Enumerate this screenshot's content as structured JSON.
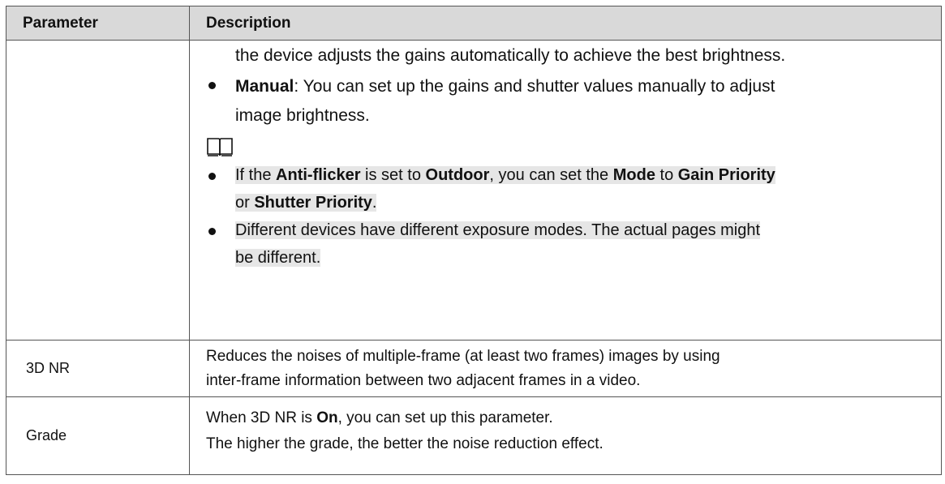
{
  "header": {
    "param": "Parameter",
    "desc": "Description"
  },
  "row1": {
    "line_cont": "the device adjusts the gains automatically to achieve the best brightness.",
    "manual_b": "Manual",
    "manual_t1": ": You can set up the gains and shutter values manually to adjust",
    "manual_t2": "image brightness.",
    "note1_a": "If the ",
    "note1_b1": "Anti-flicker",
    "note1_c": " is set to ",
    "note1_b2": "Outdoor",
    "note1_d": ", you can set the ",
    "note1_b3": "Mode",
    "note1_e": " to ",
    "note1_b4": "Gain Priority",
    "note1_f": "or ",
    "note1_b5": "Shutter Priority",
    "note1_g": ".",
    "note2_a": "Different devices have different exposure modes. The actual pages might",
    "note2_b": "be different."
  },
  "row2": {
    "param": "3D NR",
    "line1": "Reduces the noises of multiple-frame (at least two frames) images by using",
    "line2": "inter-frame information between two adjacent frames in a video."
  },
  "row3": {
    "param": "Grade",
    "line1_a": "When 3D NR is ",
    "line1_b": "On",
    "line1_c": ", you can set up this parameter.",
    "line2": "The higher the grade, the better the noise reduction effect."
  }
}
